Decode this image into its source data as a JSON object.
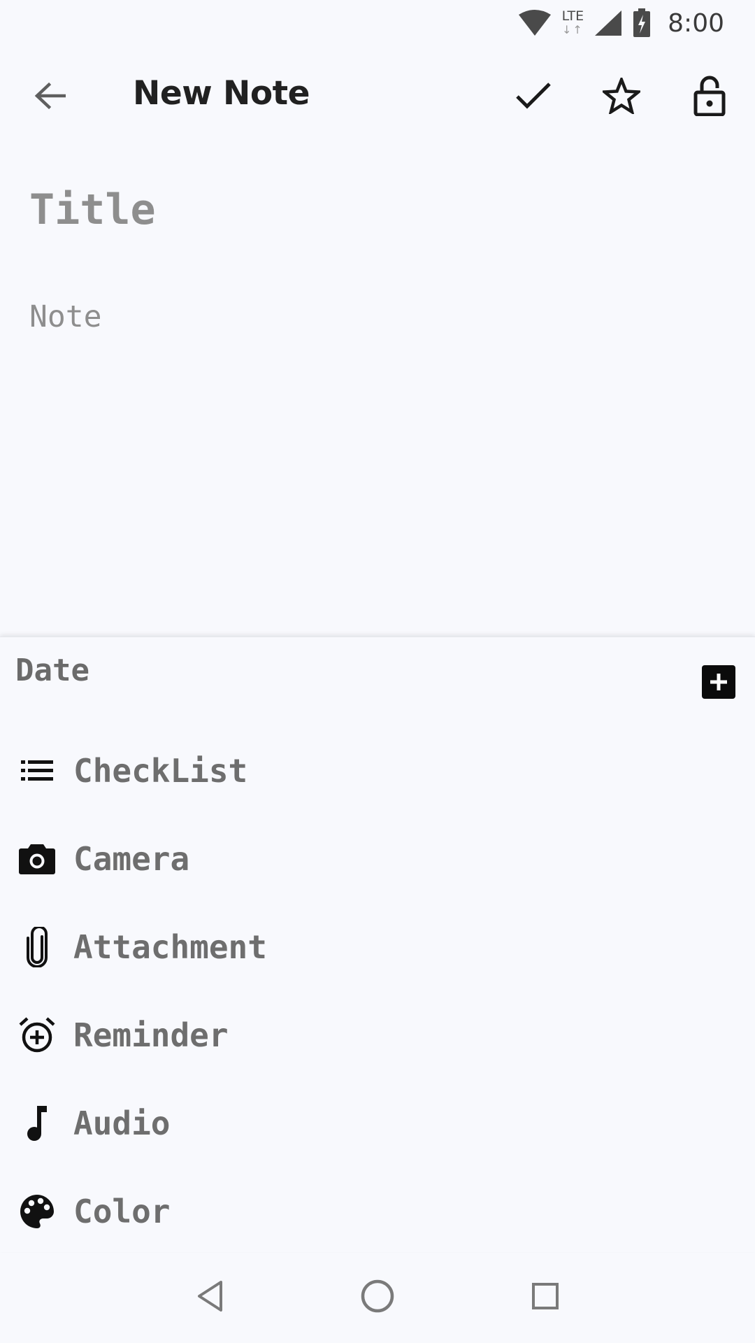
{
  "status_bar": {
    "time": "8:00",
    "network": "LTE",
    "network_arrows": "↓↑",
    "icons": [
      "wifi-icon",
      "lte-icon",
      "cell-signal-icon",
      "battery-charging-icon"
    ]
  },
  "app_bar": {
    "title": "New Note",
    "actions": [
      "check-icon",
      "star-icon",
      "lock-open-icon"
    ]
  },
  "editor": {
    "title_placeholder": "Title",
    "title_value": "",
    "note_placeholder": "Note",
    "note_value": ""
  },
  "sheet": {
    "date_label": "Date",
    "items": [
      {
        "label": "CheckList",
        "icon": "checklist-icon"
      },
      {
        "label": "Camera",
        "icon": "camera-icon"
      },
      {
        "label": "Attachment",
        "icon": "paperclip-icon"
      },
      {
        "label": "Reminder",
        "icon": "alarm-add-icon"
      },
      {
        "label": "Audio",
        "icon": "music-note-icon"
      },
      {
        "label": "Color",
        "icon": "palette-icon"
      }
    ]
  },
  "nav_bar": {
    "buttons": [
      "nav-back-icon",
      "nav-home-icon",
      "nav-recents-icon"
    ]
  }
}
